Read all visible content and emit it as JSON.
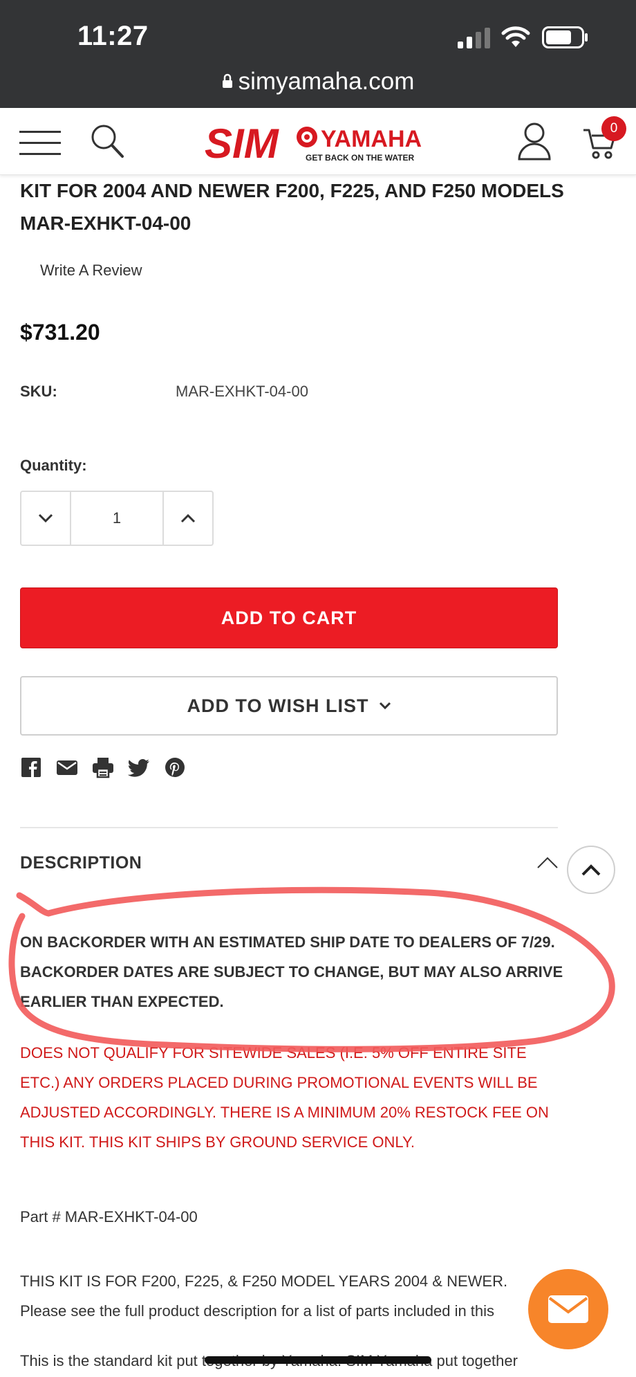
{
  "status_bar": {
    "time": "11:27"
  },
  "browser": {
    "url": "simyamaha.com"
  },
  "header": {
    "logo_text": "SIM YAMAHA",
    "logo_tagline": "GET BACK ON THE WATER",
    "cart_count": "0"
  },
  "product": {
    "title": "KIT FOR 2004 AND NEWER F200, F225, AND F250 MODELS MAR-EXHKT-04-00",
    "write_review": "Write A Review",
    "price": "$731.20",
    "sku_label": "SKU:",
    "sku_value": "MAR-EXHKT-04-00",
    "quantity_label": "Quantity:",
    "quantity_value": "1",
    "add_to_cart": "ADD TO CART",
    "add_to_wishlist": "ADD TO WISH LIST"
  },
  "share_icons": [
    "facebook-icon",
    "email-icon",
    "print-icon",
    "twitter-icon",
    "pinterest-icon"
  ],
  "description": {
    "heading": "DESCRIPTION",
    "backorder": "ON BACKORDER WITH AN ESTIMATED SHIP DATE TO DEALERS OF 7/29.  BACKORDER DATES ARE SUBJECT TO CHANGE, BUT MAY ALSO ARRIVE EARLIER THAN EXPECTED.",
    "warning": "DOES NOT QUALIFY FOR SITEWIDE SALES (I.E. 5% OFF ENTIRE SITE ETC.) ANY ORDERS PLACED DURING PROMOTIONAL EVENTS WILL BE ADJUSTED ACCORDINGLY.  THERE IS A MINIMUM 20% RESTOCK FEE ON THIS KIT. THIS KIT SHIPS BY GROUND SERVICE ONLY.",
    "part_number": "Part # MAR-EXHKT-04-00",
    "kit_for_line1": "THIS KIT IS FOR F200, F225, & F250 MODEL YEARS 2004 & NEWER.",
    "kit_for_line2": "Please see the full product description for a list of parts included in this",
    "standard_line": "This is the standard kit put together by Yamaha. SIM Yamaha put together"
  },
  "colors": {
    "status_bar": "#333436",
    "brand_red": "#ec1c24",
    "warning_red": "#d01a1a",
    "chat_orange": "#f7852a",
    "annotation_red": "#f25a5a"
  }
}
